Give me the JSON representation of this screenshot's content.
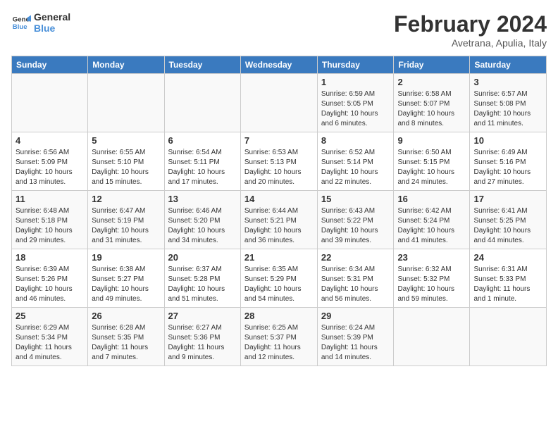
{
  "header": {
    "logo_line1": "General",
    "logo_line2": "Blue",
    "month_title": "February 2024",
    "subtitle": "Avetrana, Apulia, Italy"
  },
  "days_of_week": [
    "Sunday",
    "Monday",
    "Tuesday",
    "Wednesday",
    "Thursday",
    "Friday",
    "Saturday"
  ],
  "weeks": [
    [
      {
        "day": "",
        "info": ""
      },
      {
        "day": "",
        "info": ""
      },
      {
        "day": "",
        "info": ""
      },
      {
        "day": "",
        "info": ""
      },
      {
        "day": "1",
        "info": "Sunrise: 6:59 AM\nSunset: 5:05 PM\nDaylight: 10 hours\nand 6 minutes."
      },
      {
        "day": "2",
        "info": "Sunrise: 6:58 AM\nSunset: 5:07 PM\nDaylight: 10 hours\nand 8 minutes."
      },
      {
        "day": "3",
        "info": "Sunrise: 6:57 AM\nSunset: 5:08 PM\nDaylight: 10 hours\nand 11 minutes."
      }
    ],
    [
      {
        "day": "4",
        "info": "Sunrise: 6:56 AM\nSunset: 5:09 PM\nDaylight: 10 hours\nand 13 minutes."
      },
      {
        "day": "5",
        "info": "Sunrise: 6:55 AM\nSunset: 5:10 PM\nDaylight: 10 hours\nand 15 minutes."
      },
      {
        "day": "6",
        "info": "Sunrise: 6:54 AM\nSunset: 5:11 PM\nDaylight: 10 hours\nand 17 minutes."
      },
      {
        "day": "7",
        "info": "Sunrise: 6:53 AM\nSunset: 5:13 PM\nDaylight: 10 hours\nand 20 minutes."
      },
      {
        "day": "8",
        "info": "Sunrise: 6:52 AM\nSunset: 5:14 PM\nDaylight: 10 hours\nand 22 minutes."
      },
      {
        "day": "9",
        "info": "Sunrise: 6:50 AM\nSunset: 5:15 PM\nDaylight: 10 hours\nand 24 minutes."
      },
      {
        "day": "10",
        "info": "Sunrise: 6:49 AM\nSunset: 5:16 PM\nDaylight: 10 hours\nand 27 minutes."
      }
    ],
    [
      {
        "day": "11",
        "info": "Sunrise: 6:48 AM\nSunset: 5:18 PM\nDaylight: 10 hours\nand 29 minutes."
      },
      {
        "day": "12",
        "info": "Sunrise: 6:47 AM\nSunset: 5:19 PM\nDaylight: 10 hours\nand 31 minutes."
      },
      {
        "day": "13",
        "info": "Sunrise: 6:46 AM\nSunset: 5:20 PM\nDaylight: 10 hours\nand 34 minutes."
      },
      {
        "day": "14",
        "info": "Sunrise: 6:44 AM\nSunset: 5:21 PM\nDaylight: 10 hours\nand 36 minutes."
      },
      {
        "day": "15",
        "info": "Sunrise: 6:43 AM\nSunset: 5:22 PM\nDaylight: 10 hours\nand 39 minutes."
      },
      {
        "day": "16",
        "info": "Sunrise: 6:42 AM\nSunset: 5:24 PM\nDaylight: 10 hours\nand 41 minutes."
      },
      {
        "day": "17",
        "info": "Sunrise: 6:41 AM\nSunset: 5:25 PM\nDaylight: 10 hours\nand 44 minutes."
      }
    ],
    [
      {
        "day": "18",
        "info": "Sunrise: 6:39 AM\nSunset: 5:26 PM\nDaylight: 10 hours\nand 46 minutes."
      },
      {
        "day": "19",
        "info": "Sunrise: 6:38 AM\nSunset: 5:27 PM\nDaylight: 10 hours\nand 49 minutes."
      },
      {
        "day": "20",
        "info": "Sunrise: 6:37 AM\nSunset: 5:28 PM\nDaylight: 10 hours\nand 51 minutes."
      },
      {
        "day": "21",
        "info": "Sunrise: 6:35 AM\nSunset: 5:29 PM\nDaylight: 10 hours\nand 54 minutes."
      },
      {
        "day": "22",
        "info": "Sunrise: 6:34 AM\nSunset: 5:31 PM\nDaylight: 10 hours\nand 56 minutes."
      },
      {
        "day": "23",
        "info": "Sunrise: 6:32 AM\nSunset: 5:32 PM\nDaylight: 10 hours\nand 59 minutes."
      },
      {
        "day": "24",
        "info": "Sunrise: 6:31 AM\nSunset: 5:33 PM\nDaylight: 11 hours\nand 1 minute."
      }
    ],
    [
      {
        "day": "25",
        "info": "Sunrise: 6:29 AM\nSunset: 5:34 PM\nDaylight: 11 hours\nand 4 minutes."
      },
      {
        "day": "26",
        "info": "Sunrise: 6:28 AM\nSunset: 5:35 PM\nDaylight: 11 hours\nand 7 minutes."
      },
      {
        "day": "27",
        "info": "Sunrise: 6:27 AM\nSunset: 5:36 PM\nDaylight: 11 hours\nand 9 minutes."
      },
      {
        "day": "28",
        "info": "Sunrise: 6:25 AM\nSunset: 5:37 PM\nDaylight: 11 hours\nand 12 minutes."
      },
      {
        "day": "29",
        "info": "Sunrise: 6:24 AM\nSunset: 5:39 PM\nDaylight: 11 hours\nand 14 minutes."
      },
      {
        "day": "",
        "info": ""
      },
      {
        "day": "",
        "info": ""
      }
    ]
  ]
}
